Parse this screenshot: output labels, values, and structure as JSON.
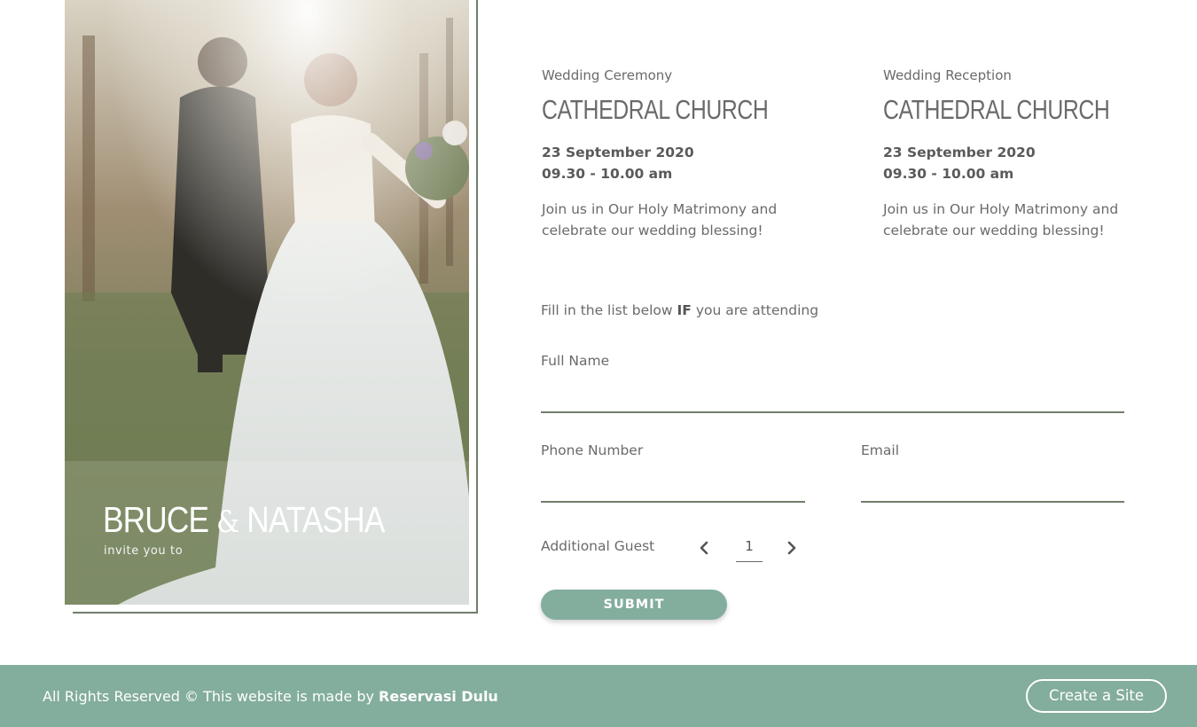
{
  "hero": {
    "bride_groom_first": "BRUCE",
    "ampersand": "&",
    "bride_groom_second": "NATASHA",
    "invite_text": "invite you to"
  },
  "events": [
    {
      "type": "Wedding Ceremony",
      "venue": "CATHEDRAL CHURCH",
      "date": "23 September 2020",
      "time": "09.30 - 10.00 am",
      "description": "Join us in Our Holy Matrimony and celebrate our wedding blessing!"
    },
    {
      "type": "Wedding Reception",
      "venue": "CATHEDRAL CHURCH",
      "date": "23 September 2020",
      "time": "09.30 - 10.00 am",
      "description": "Join us in Our Holy Matrimony and celebrate our wedding blessing!"
    }
  ],
  "form": {
    "intro_before": "Fill in the list below ",
    "intro_bold": "IF",
    "intro_after": " you are attending",
    "full_name_label": "Full Name",
    "full_name_value": "",
    "phone_label": "Phone Number",
    "phone_value": "",
    "email_label": "Email",
    "email_value": "",
    "guest_label": "Additional Guest",
    "guest_count": "1",
    "prev_icon": "chevron-left-icon",
    "next_icon": "chevron-right-icon",
    "submit_label": "SUBMIT"
  },
  "footer": {
    "text": "All Rights Reserved © This website is made by ",
    "brand": "Reservasi Dulu",
    "create_label": "Create a Site"
  },
  "colors": {
    "accent": "#83ad9d",
    "line": "#6f7f6a",
    "text": "#6a6a6a"
  }
}
